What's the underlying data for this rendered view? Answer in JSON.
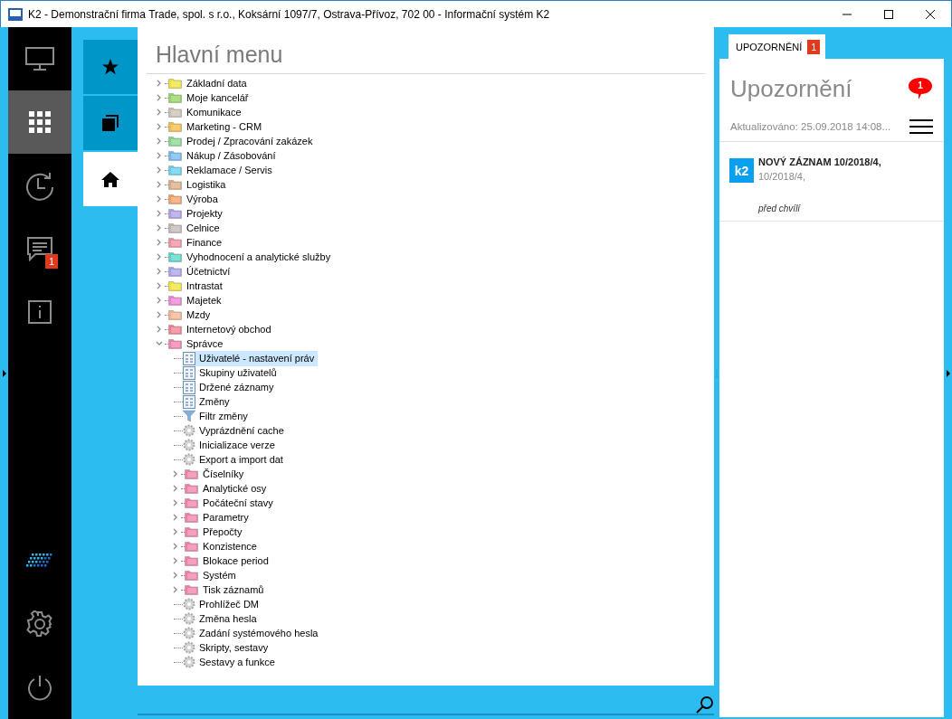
{
  "window": {
    "title": "K2 - Demonstrační firma Trade, spol. s r.o., Koksární 1097/7, Ostrava-Přívoz, 702 00 - Informační systém K2"
  },
  "sidebar": {
    "items": [
      {
        "kind": "monitor",
        "selected": false
      },
      {
        "kind": "apps",
        "selected": true
      },
      {
        "kind": "history",
        "selected": false
      },
      {
        "kind": "messages",
        "selected": false,
        "badge": "1"
      },
      {
        "kind": "info",
        "selected": false
      }
    ],
    "bottom_items": [
      {
        "kind": "logo"
      },
      {
        "kind": "settings"
      },
      {
        "kind": "power"
      }
    ]
  },
  "tabs": [
    {
      "kind": "favorites",
      "selected": false
    },
    {
      "kind": "windows",
      "selected": false
    },
    {
      "kind": "home",
      "selected": true
    }
  ],
  "main_menu": {
    "title": "Hlavní menu",
    "tree": [
      {
        "label": "Základní data",
        "color": "#f2e22a",
        "expanded": false
      },
      {
        "label": "Moje kancelář",
        "color": "#8fd35a",
        "expanded": false
      },
      {
        "label": "Komunikace",
        "color": "#c9bdb0",
        "expanded": false
      },
      {
        "label": "Marketing - CRM",
        "color": "#f5b83a",
        "expanded": false
      },
      {
        "label": "Prodej / Zpracování zakázek",
        "color": "#7fd48a",
        "expanded": false
      },
      {
        "label": "Nákup / Zásobování",
        "color": "#6cb4ef",
        "expanded": false
      },
      {
        "label": "Reklamace / Servis",
        "color": "#5ccdf0",
        "expanded": false
      },
      {
        "label": "Logistika",
        "color": "#d6aa7c",
        "expanded": false
      },
      {
        "label": "Výroba",
        "color": "#f59a5e",
        "expanded": false
      },
      {
        "label": "Projekty",
        "color": "#a59ae6",
        "expanded": false
      },
      {
        "label": "Celnice",
        "color": "#bdb6b0",
        "expanded": false
      },
      {
        "label": "Finance",
        "color": "#f08a9a",
        "expanded": false
      },
      {
        "label": "Vyhodnocení a analytické služby",
        "color": "#4fd6c2",
        "expanded": false
      },
      {
        "label": "Účetnictví",
        "color": "#a59ae6",
        "expanded": false
      },
      {
        "label": "Intrastat",
        "color": "#f2e22a",
        "expanded": false
      },
      {
        "label": "Majetek",
        "color": "#ec7ccf",
        "expanded": false
      },
      {
        "label": "Mzdy",
        "color": "#f5b08a",
        "expanded": false
      },
      {
        "label": "Internetový obchod",
        "color": "#f27a8a",
        "expanded": false
      },
      {
        "label": "Správce",
        "color": "#f27aa6",
        "expanded": true,
        "children": [
          {
            "kind": "table",
            "label": "Uživatelé - nastavení práv",
            "selected": true
          },
          {
            "kind": "table",
            "label": "Skupiny uživatelů",
            "selected": false
          },
          {
            "kind": "table",
            "label": "Držené záznamy",
            "selected": false
          },
          {
            "kind": "table",
            "label": "Změny",
            "selected": false
          },
          {
            "kind": "filter",
            "label": "Filtr změny",
            "selected": false
          },
          {
            "kind": "action",
            "label": "Vyprázdnění cache",
            "selected": false
          },
          {
            "kind": "action",
            "label": "Inicializace verze",
            "selected": false
          },
          {
            "kind": "action",
            "label": "Export a import dat",
            "selected": false
          },
          {
            "kind": "folder",
            "label": "Číselníky",
            "selected": false
          },
          {
            "kind": "folder",
            "label": "Analytické osy",
            "selected": false
          },
          {
            "kind": "folder",
            "label": "Počáteční stavy",
            "selected": false
          },
          {
            "kind": "folder",
            "label": "Parametry",
            "selected": false
          },
          {
            "kind": "folder",
            "label": "Přepočty",
            "selected": false
          },
          {
            "kind": "folder",
            "label": "Konzistence",
            "selected": false
          },
          {
            "kind": "folder",
            "label": "Blokace period",
            "selected": false
          },
          {
            "kind": "folder",
            "label": "Systém",
            "selected": false
          },
          {
            "kind": "folder",
            "label": "Tisk záznamů",
            "selected": false
          },
          {
            "kind": "action",
            "label": "Prohlížeč DM",
            "selected": false
          },
          {
            "kind": "action",
            "label": "Změna hesla",
            "selected": false
          },
          {
            "kind": "action",
            "label": "Zadání systémového hesla",
            "selected": false
          },
          {
            "kind": "action",
            "label": "Skripty, sestavy",
            "selected": false
          },
          {
            "kind": "action",
            "label": "Sestavy a funkce",
            "selected": false
          }
        ]
      }
    ]
  },
  "notifications": {
    "tab": {
      "label": "UPOZORNĚNÍ",
      "badge": "1"
    },
    "title": "Upozornění",
    "bubble": "1",
    "updated": "Aktualizováno: 25.09.2018 14:08...",
    "items": [
      {
        "logo": "k2",
        "title": "NOVÝ ZÁZNAM 10/2018/4,",
        "subtitle": "10/2018/4,",
        "time": "před chvílí"
      }
    ]
  }
}
